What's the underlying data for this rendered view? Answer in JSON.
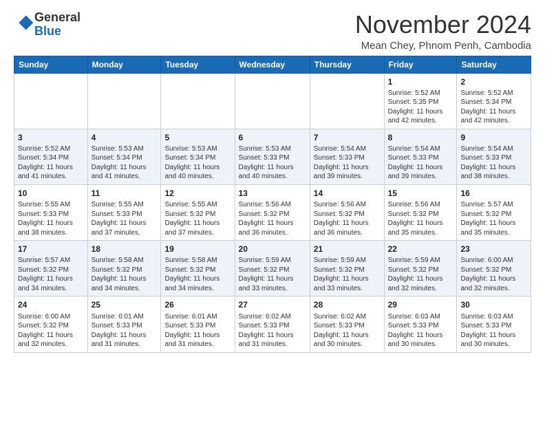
{
  "header": {
    "logo_general": "General",
    "logo_blue": "Blue",
    "month_title": "November 2024",
    "location": "Mean Chey, Phnom Penh, Cambodia"
  },
  "days_of_week": [
    "Sunday",
    "Monday",
    "Tuesday",
    "Wednesday",
    "Thursday",
    "Friday",
    "Saturday"
  ],
  "weeks": [
    [
      {
        "day": "",
        "info": ""
      },
      {
        "day": "",
        "info": ""
      },
      {
        "day": "",
        "info": ""
      },
      {
        "day": "",
        "info": ""
      },
      {
        "day": "",
        "info": ""
      },
      {
        "day": "1",
        "info": "Sunrise: 5:52 AM\nSunset: 5:35 PM\nDaylight: 11 hours\nand 42 minutes."
      },
      {
        "day": "2",
        "info": "Sunrise: 5:52 AM\nSunset: 5:34 PM\nDaylight: 11 hours\nand 42 minutes."
      }
    ],
    [
      {
        "day": "3",
        "info": "Sunrise: 5:52 AM\nSunset: 5:34 PM\nDaylight: 11 hours\nand 41 minutes."
      },
      {
        "day": "4",
        "info": "Sunrise: 5:53 AM\nSunset: 5:34 PM\nDaylight: 11 hours\nand 41 minutes."
      },
      {
        "day": "5",
        "info": "Sunrise: 5:53 AM\nSunset: 5:34 PM\nDaylight: 11 hours\nand 40 minutes."
      },
      {
        "day": "6",
        "info": "Sunrise: 5:53 AM\nSunset: 5:33 PM\nDaylight: 11 hours\nand 40 minutes."
      },
      {
        "day": "7",
        "info": "Sunrise: 5:54 AM\nSunset: 5:33 PM\nDaylight: 11 hours\nand 39 minutes."
      },
      {
        "day": "8",
        "info": "Sunrise: 5:54 AM\nSunset: 5:33 PM\nDaylight: 11 hours\nand 39 minutes."
      },
      {
        "day": "9",
        "info": "Sunrise: 5:54 AM\nSunset: 5:33 PM\nDaylight: 11 hours\nand 38 minutes."
      }
    ],
    [
      {
        "day": "10",
        "info": "Sunrise: 5:55 AM\nSunset: 5:33 PM\nDaylight: 11 hours\nand 38 minutes."
      },
      {
        "day": "11",
        "info": "Sunrise: 5:55 AM\nSunset: 5:33 PM\nDaylight: 11 hours\nand 37 minutes."
      },
      {
        "day": "12",
        "info": "Sunrise: 5:55 AM\nSunset: 5:32 PM\nDaylight: 11 hours\nand 37 minutes."
      },
      {
        "day": "13",
        "info": "Sunrise: 5:56 AM\nSunset: 5:32 PM\nDaylight: 11 hours\nand 36 minutes."
      },
      {
        "day": "14",
        "info": "Sunrise: 5:56 AM\nSunset: 5:32 PM\nDaylight: 11 hours\nand 36 minutes."
      },
      {
        "day": "15",
        "info": "Sunrise: 5:56 AM\nSunset: 5:32 PM\nDaylight: 11 hours\nand 35 minutes."
      },
      {
        "day": "16",
        "info": "Sunrise: 5:57 AM\nSunset: 5:32 PM\nDaylight: 11 hours\nand 35 minutes."
      }
    ],
    [
      {
        "day": "17",
        "info": "Sunrise: 5:57 AM\nSunset: 5:32 PM\nDaylight: 11 hours\nand 34 minutes."
      },
      {
        "day": "18",
        "info": "Sunrise: 5:58 AM\nSunset: 5:32 PM\nDaylight: 11 hours\nand 34 minutes."
      },
      {
        "day": "19",
        "info": "Sunrise: 5:58 AM\nSunset: 5:32 PM\nDaylight: 11 hours\nand 34 minutes."
      },
      {
        "day": "20",
        "info": "Sunrise: 5:59 AM\nSunset: 5:32 PM\nDaylight: 11 hours\nand 33 minutes."
      },
      {
        "day": "21",
        "info": "Sunrise: 5:59 AM\nSunset: 5:32 PM\nDaylight: 11 hours\nand 33 minutes."
      },
      {
        "day": "22",
        "info": "Sunrise: 5:59 AM\nSunset: 5:32 PM\nDaylight: 11 hours\nand 32 minutes."
      },
      {
        "day": "23",
        "info": "Sunrise: 6:00 AM\nSunset: 5:32 PM\nDaylight: 11 hours\nand 32 minutes."
      }
    ],
    [
      {
        "day": "24",
        "info": "Sunrise: 6:00 AM\nSunset: 5:32 PM\nDaylight: 11 hours\nand 32 minutes."
      },
      {
        "day": "25",
        "info": "Sunrise: 6:01 AM\nSunset: 5:33 PM\nDaylight: 11 hours\nand 31 minutes."
      },
      {
        "day": "26",
        "info": "Sunrise: 6:01 AM\nSunset: 5:33 PM\nDaylight: 11 hours\nand 31 minutes."
      },
      {
        "day": "27",
        "info": "Sunrise: 6:02 AM\nSunset: 5:33 PM\nDaylight: 11 hours\nand 31 minutes."
      },
      {
        "day": "28",
        "info": "Sunrise: 6:02 AM\nSunset: 5:33 PM\nDaylight: 11 hours\nand 30 minutes."
      },
      {
        "day": "29",
        "info": "Sunrise: 6:03 AM\nSunset: 5:33 PM\nDaylight: 11 hours\nand 30 minutes."
      },
      {
        "day": "30",
        "info": "Sunrise: 6:03 AM\nSunset: 5:33 PM\nDaylight: 11 hours\nand 30 minutes."
      }
    ]
  ]
}
